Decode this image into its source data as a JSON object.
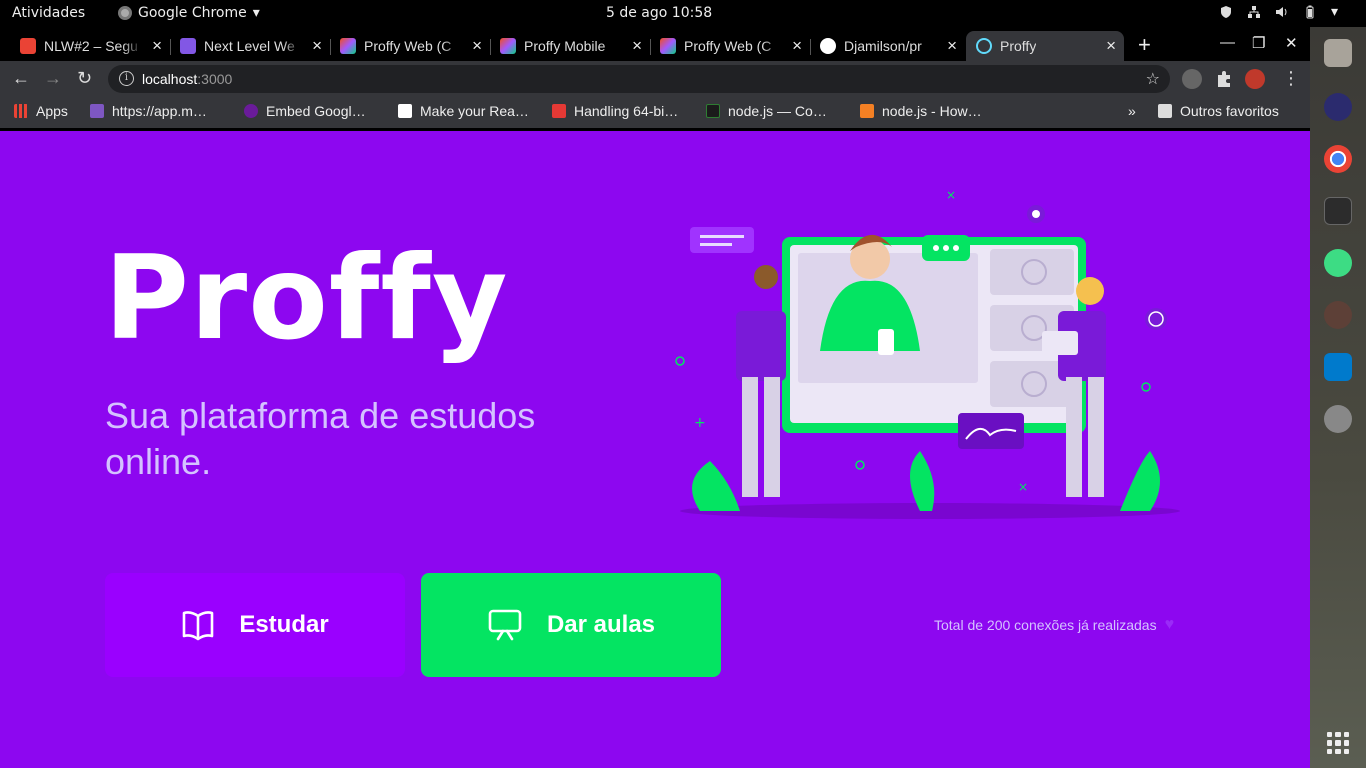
{
  "system": {
    "activities": "Atividades",
    "app_menu": "Google Chrome",
    "clock": "5 de ago  10:58"
  },
  "tabs": [
    {
      "label": "NLW#2 – Segu",
      "favicon_color": "#ea4335"
    },
    {
      "label": "Next Level We",
      "favicon_color": "#8257e5"
    },
    {
      "label": "Proffy Web (C",
      "favicon_color": "#f24e1e"
    },
    {
      "label": "Proffy Mobile",
      "favicon_color": "#f24e1e"
    },
    {
      "label": "Proffy Web (C",
      "favicon_color": "#f24e1e"
    },
    {
      "label": "Djamilson/pr",
      "favicon_color": "#ffffff"
    },
    {
      "label": "Proffy",
      "favicon_color": "#61dafb"
    }
  ],
  "address_bar": {
    "host": "localhost",
    "port": ":3000"
  },
  "bookmarks": [
    {
      "label": "Apps",
      "icon_color": "#ea4335"
    },
    {
      "label": "https://app.m…",
      "icon_color": "#7e57c2"
    },
    {
      "label": "Embed Googl…",
      "icon_color": "#6a1b9a"
    },
    {
      "label": "Make your Rea…",
      "icon_color": "#ffffff"
    },
    {
      "label": "Handling 64-bi…",
      "icon_color": "#e53935"
    },
    {
      "label": "node.js — Co…",
      "icon_color": "#2e7d32"
    },
    {
      "label": "node.js - How…",
      "icon_color": "#f48024"
    },
    {
      "label": "Outros favoritos",
      "icon_color": "#dddddd"
    }
  ],
  "landing": {
    "logo": "Proffy",
    "tagline": "Sua plataforma de estudos online.",
    "study_button": "Estudar",
    "teach_button": "Dar aulas",
    "total_connections": "Total de 200 conexões já realizadas"
  },
  "colors": {
    "background": "#8d07f0",
    "study_button": "#9a00ff",
    "teach_button": "#04e462",
    "tagline": "#d4c2ff"
  }
}
